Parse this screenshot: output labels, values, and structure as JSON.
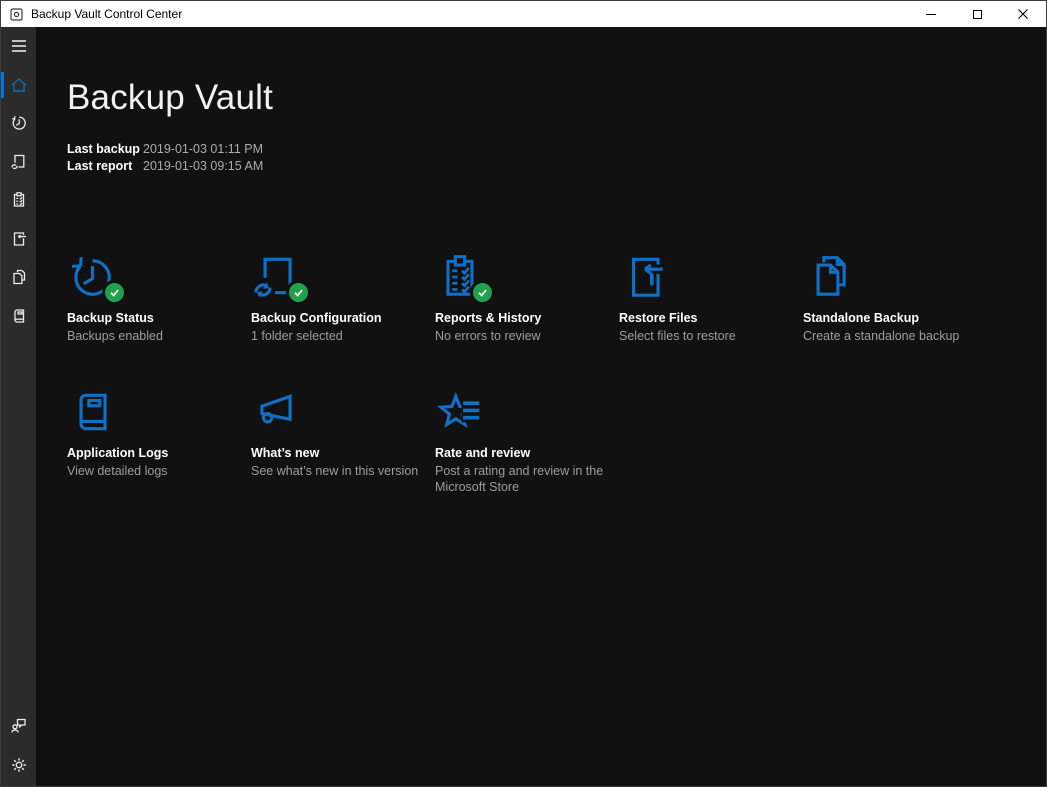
{
  "window": {
    "title": "Backup Vault Control Center",
    "controls": [
      {
        "icon": "minimize-icon"
      },
      {
        "icon": "maximize-icon"
      },
      {
        "icon": "close-icon"
      }
    ]
  },
  "sidebar": {
    "items": [
      {
        "icon": "menu-icon",
        "selected": false
      },
      {
        "icon": "home-icon",
        "selected": true
      },
      {
        "icon": "history-icon",
        "selected": false
      },
      {
        "icon": "sync-document-icon",
        "selected": false
      },
      {
        "icon": "clipboard-checklist-icon",
        "selected": false
      },
      {
        "icon": "restore-document-icon",
        "selected": false
      },
      {
        "icon": "copy-pages-icon",
        "selected": false
      },
      {
        "icon": "book-icon",
        "selected": false
      }
    ],
    "footer_items": [
      {
        "icon": "feedback-icon"
      },
      {
        "icon": "settings-gear-icon"
      }
    ]
  },
  "header": {
    "title": "Backup Vault"
  },
  "status": {
    "rows": [
      {
        "label": "Last backup",
        "value": "2019-01-03 01:11 PM"
      },
      {
        "label": "Last report",
        "value": "2019-01-03 09:15 AM"
      }
    ]
  },
  "tiles": [
    {
      "title": "Backup Status",
      "subtitle": "Backups enabled",
      "icon": "history-icon",
      "badge": "check"
    },
    {
      "title": "Backup Configuration",
      "subtitle": "1 folder selected",
      "icon": "sync-document-icon",
      "badge": "check"
    },
    {
      "title": "Reports & History",
      "subtitle": "No errors to review",
      "icon": "clipboard-checklist-icon",
      "badge": "check"
    },
    {
      "title": "Restore Files",
      "subtitle": "Select files to restore",
      "icon": "restore-document-icon",
      "badge": null
    },
    {
      "title": "Standalone Backup",
      "subtitle": "Create a standalone backup",
      "icon": "copy-pages-icon",
      "badge": null
    },
    {
      "title": "Application Logs",
      "subtitle": "View detailed logs",
      "icon": "book-icon",
      "badge": null
    },
    {
      "title": "What’s new",
      "subtitle": "See what’s new in this version",
      "icon": "megaphone-icon",
      "badge": null
    },
    {
      "title": "Rate and review",
      "subtitle": "Post a rating and review in the Microsoft Store",
      "icon": "rate-star-icon",
      "badge": null
    }
  ],
  "colors": {
    "titlebar_bg": "#ffffff",
    "sidebar_bg": "#2b2b2b",
    "main_bg": "#111111",
    "accent_blue": "#0078d7",
    "tile_icon_blue": "#0f70c5",
    "badge_green": "#21a14c",
    "tile_title": "#ffffff",
    "tile_subtitle": "#9d9d9d"
  }
}
